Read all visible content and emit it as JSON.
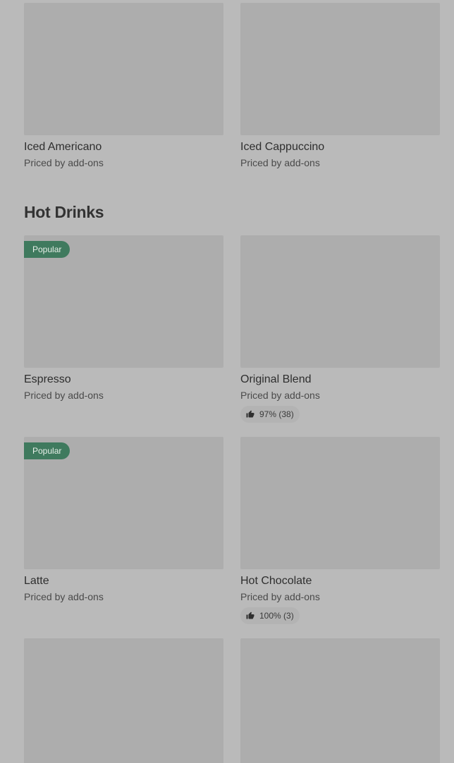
{
  "iced_drinks": {
    "items": [
      {
        "name": "Iced Americano",
        "price": "Priced by add-ons"
      },
      {
        "name": "Iced Cappuccino",
        "price": "Priced by add-ons"
      }
    ]
  },
  "hot_drinks": {
    "title": "Hot Drinks",
    "items": [
      {
        "name": "Espresso",
        "price": "Priced by add-ons",
        "badge": "Popular"
      },
      {
        "name": "Original Blend",
        "price": "Priced by add-ons",
        "rating": "97% (38)"
      },
      {
        "name": "Latte",
        "price": "Priced by add-ons",
        "badge": "Popular"
      },
      {
        "name": "Hot Chocolate",
        "price": "Priced by add-ons",
        "rating": "100% (3)"
      }
    ]
  },
  "icons": {
    "rating": "thumbs-up-icon"
  },
  "colors": {
    "badge_background": "#3f7a5e",
    "page_background": "#bababa",
    "image_placeholder": "#adadad"
  }
}
